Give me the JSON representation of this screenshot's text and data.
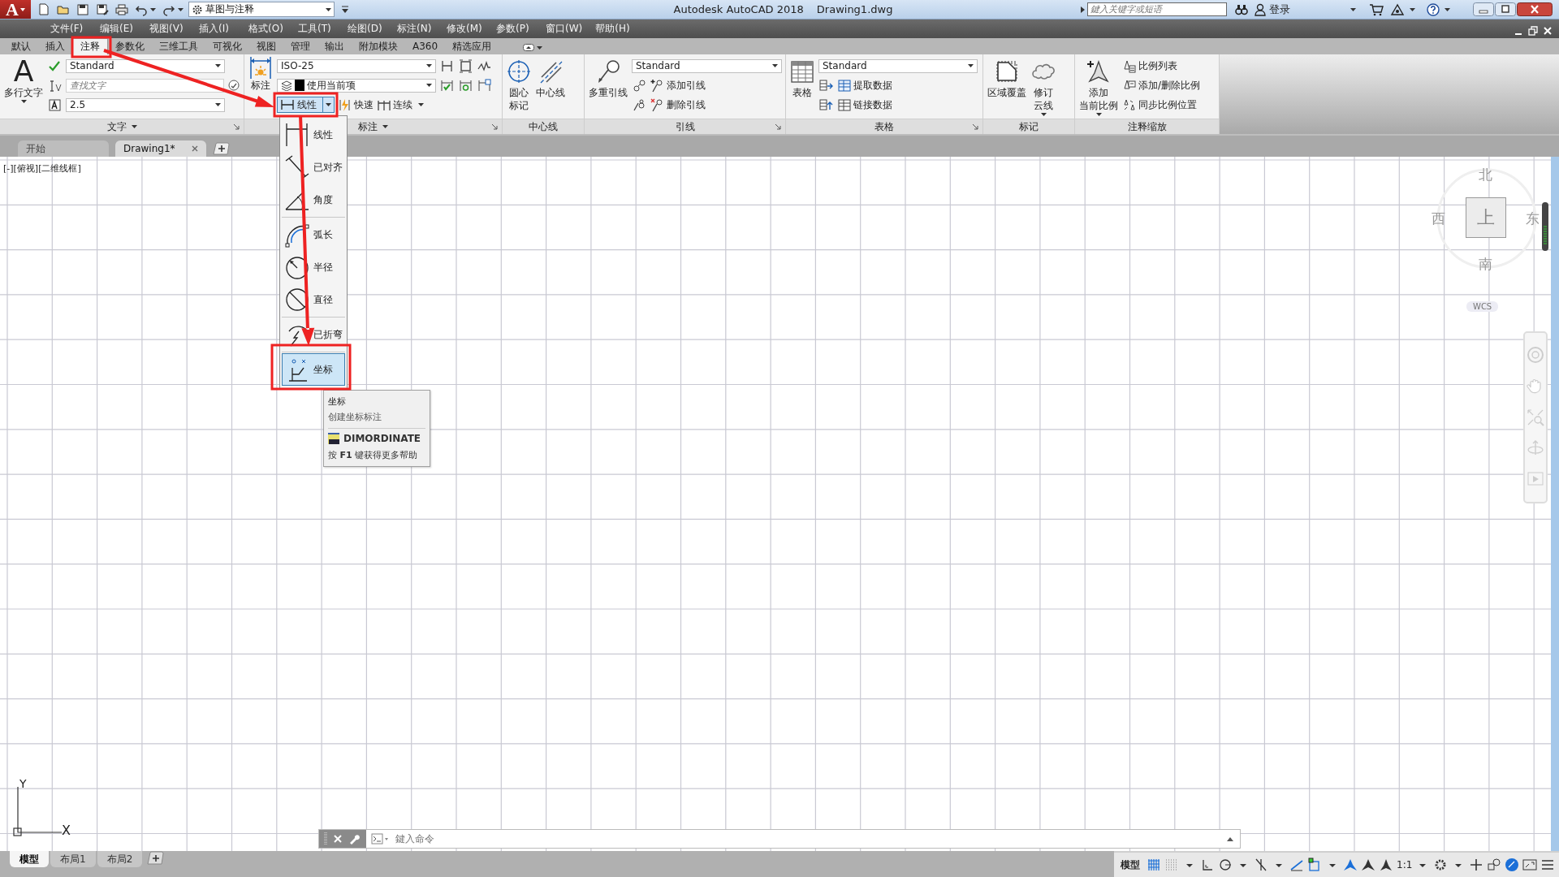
{
  "title_bar": {
    "logo": "A",
    "workspace": "草图与注释",
    "title": "Autodesk AutoCAD 2018",
    "document": "Drawing1.dwg",
    "search": {
      "placeholder": "鍵入关键字或短语"
    },
    "user": "登录"
  },
  "menu_bar": [
    "文件(F)",
    "编辑(E)",
    "视图(V)",
    "插入(I)",
    "格式(O)",
    "工具(T)",
    "绘图(D)",
    "标注(N)",
    "修改(M)",
    "参数(P)",
    "窗口(W)",
    "帮助(H)"
  ],
  "ribbon_tabs": [
    {
      "label": "默认",
      "selected": false
    },
    {
      "label": "插入",
      "selected": false
    },
    {
      "label": "注释",
      "selected": true
    },
    {
      "label": "参数化",
      "selected": false
    },
    {
      "label": "三维工具",
      "selected": false
    },
    {
      "label": "可视化",
      "selected": false
    },
    {
      "label": "视图",
      "selected": false
    },
    {
      "label": "管理",
      "selected": false
    },
    {
      "label": "输出",
      "selected": false
    },
    {
      "label": "附加模块",
      "selected": false
    },
    {
      "label": "A360",
      "selected": false
    },
    {
      "label": "精选应用",
      "selected": false
    }
  ],
  "ribbon_panels": [
    {
      "title": "文字",
      "title_menu": true,
      "launcher": true,
      "items": [
        {
          "kind": "large",
          "glyph": "A",
          "lines": [
            "多行文字"
          ],
          "dropdown": true
        },
        {
          "kind": "stack",
          "rows": [
            [
              {
                "kind": "tool"
              },
              {
                "kind": "combo",
                "value": "Standard"
              }
            ],
            [
              {
                "kind": "tool"
              },
              {
                "kind": "field",
                "placeholder": "查找文字"
              }
            ],
            [
              {
                "kind": "tool"
              },
              {
                "kind": "combo",
                "value": "2.5"
              }
            ]
          ]
        }
      ]
    },
    {
      "title": "标注",
      "title_menu": true,
      "launcher": true,
      "items": [
        {
          "kind": "large",
          "lines": [
            "标注"
          ],
          "dropdown": false
        },
        {
          "kind": "stack",
          "rows": [
            [
              {
                "kind": "combo",
                "value": "ISO-25"
              },
              {
                "kind": "tool"
              },
              {
                "kind": "tool"
              },
              {
                "kind": "tool"
              }
            ],
            [
              {
                "kind": "color_combo",
                "value": "使用当前项"
              },
              {
                "kind": "tool"
              },
              {
                "kind": "tool"
              },
              {
                "kind": "tool"
              }
            ],
            [
              {
                "kind": "split",
                "label": "线性",
                "expanded": true
              },
              {
                "kind": "button",
                "label": "快速",
                "dropdown": false
              },
              {
                "kind": "button",
                "label": "连续",
                "dropdown": true
              }
            ]
          ]
        }
      ]
    },
    {
      "title": "中心线",
      "title_menu": false,
      "launcher": false,
      "items": [
        {
          "kind": "large",
          "lines": [
            "圆心",
            "标记"
          ],
          "dropdown": false
        },
        {
          "kind": "large",
          "lines": [
            "中心线"
          ],
          "dropdown": false
        }
      ]
    },
    {
      "title": "引线",
      "title_menu": false,
      "launcher": true,
      "items": [
        {
          "kind": "large",
          "lines": [
            "多重引线"
          ],
          "dropdown": false
        },
        {
          "kind": "stack",
          "rows": [
            [
              {
                "kind": "combo",
                "value": "Standard"
              }
            ],
            [
              {
                "kind": "tool"
              },
              {
                "kind": "button",
                "label": "添加引线",
                "dropdown": false
              }
            ],
            [
              {
                "kind": "tool"
              },
              {
                "kind": "button",
                "label": "删除引线",
                "dropdown": false
              }
            ]
          ]
        }
      ]
    },
    {
      "title": "表格",
      "title_menu": false,
      "launcher": true,
      "items": [
        {
          "kind": "large",
          "lines": [
            "表格"
          ],
          "dropdown": false
        },
        {
          "kind": "stack",
          "rows": [
            [
              {
                "kind": "combo",
                "value": "Standard"
              }
            ],
            [
              {
                "kind": "tool"
              },
              {
                "kind": "button",
                "label": "提取数据",
                "dropdown": false
              }
            ],
            [
              {
                "kind": "tool"
              },
              {
                "kind": "button",
                "label": "链接数据",
                "dropdown": false
              }
            ]
          ]
        }
      ]
    },
    {
      "title": "标记",
      "title_menu": false,
      "launcher": false,
      "items": [
        {
          "kind": "large",
          "lines": [
            "区域覆盖"
          ],
          "dropdown": false
        },
        {
          "kind": "large",
          "lines": [
            "修订",
            "云线"
          ],
          "dropdown": true
        }
      ]
    },
    {
      "title": "注释缩放",
      "title_menu": false,
      "launcher": false,
      "items": [
        {
          "kind": "large",
          "lines": [
            "添加",
            "当前比例"
          ],
          "dropdown": true
        },
        {
          "kind": "stack",
          "rows": [
            [
              {
                "kind": "button",
                "label": "比例列表",
                "dropdown": false
              }
            ],
            [
              {
                "kind": "button",
                "label": "添加/删除比例",
                "dropdown": false
              }
            ],
            [
              {
                "kind": "button",
                "label": "同步比例位置",
                "dropdown": false
              }
            ]
          ]
        }
      ]
    }
  ],
  "document_tabs": [
    {
      "label": "开始",
      "selected": false,
      "closable": false
    },
    {
      "label": "Drawing1*",
      "selected": true,
      "closable": true
    }
  ],
  "viewport_label": "[-][俯视][二维线框]",
  "dimension_menu": {
    "groups": [
      [
        {
          "label": "线性",
          "selected": false
        },
        {
          "label": "已对齐",
          "selected": false
        },
        {
          "label": "角度",
          "selected": false
        }
      ],
      [
        {
          "label": "弧长",
          "selected": false
        },
        {
          "label": "半径",
          "selected": false
        },
        {
          "label": "直径",
          "selected": false
        }
      ],
      [
        {
          "label": "已折弯",
          "selected": false
        }
      ],
      [
        {
          "label": "坐标",
          "selected": true
        }
      ]
    ]
  },
  "tooltip": {
    "title": "坐标",
    "description": "创建坐标标注",
    "command": "DIMORDINATE",
    "help": "按 **F1** 键获得更多帮助"
  },
  "viewcube": {
    "north": "北",
    "south": "南",
    "east": "东",
    "west": "西",
    "face": "上",
    "ucs": "WCS"
  },
  "ucs_icon": {
    "x": "X",
    "y": "Y"
  },
  "command_line": {
    "placeholder": "鍵入命令"
  },
  "layout_tabs": [
    {
      "label": "模型",
      "selected": true
    },
    {
      "label": "布局1",
      "selected": false
    },
    {
      "label": "布局2",
      "selected": false
    }
  ],
  "status_bar": {
    "mode": "模型",
    "scale": "1:1"
  }
}
